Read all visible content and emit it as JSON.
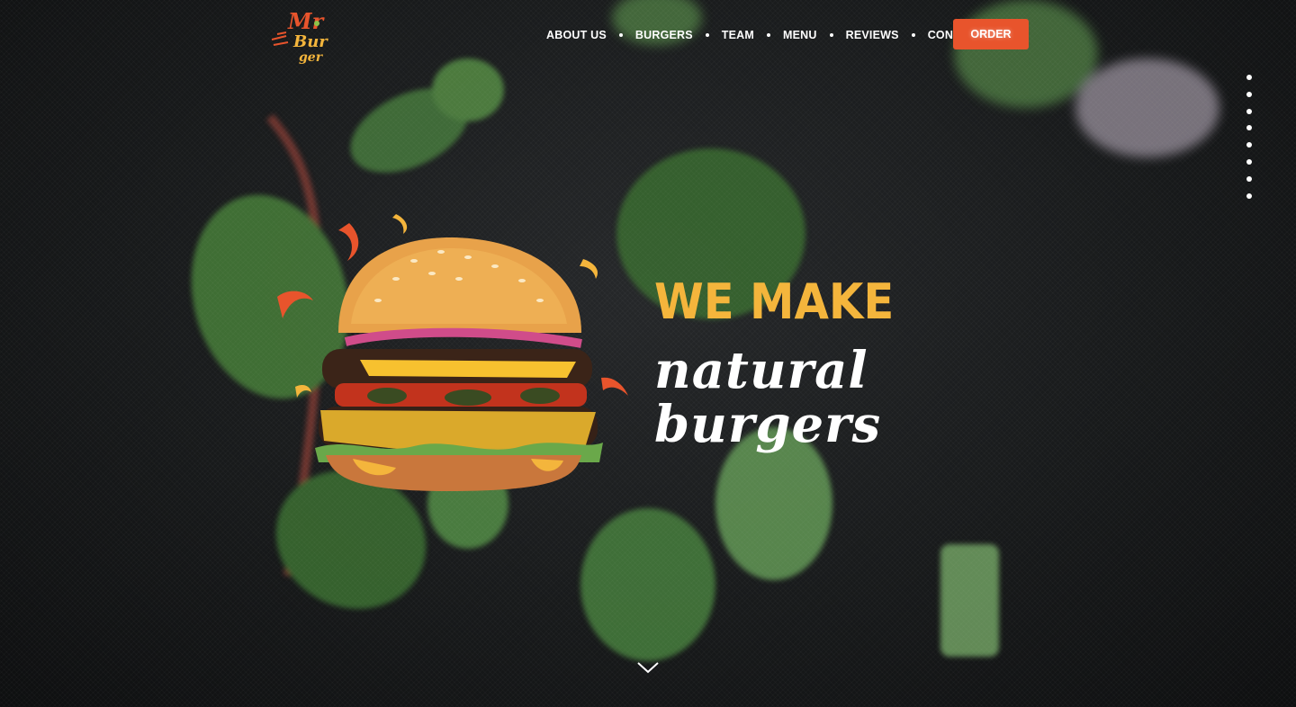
{
  "brand": {
    "logo_text": "Mr Burger",
    "colors": {
      "accent": "#e8542c",
      "yellow": "#f4b53c",
      "background": "#141516"
    }
  },
  "nav": {
    "items": [
      {
        "label": "ABOUT US"
      },
      {
        "label": "BURGERS"
      },
      {
        "label": "TEAM"
      },
      {
        "label": "MENU"
      },
      {
        "label": "REVIEWS"
      },
      {
        "label": "CONTACTS"
      }
    ],
    "order_label": "ORDER"
  },
  "pager": {
    "count": 8,
    "active_index": 0
  },
  "hero": {
    "line1": "WE MAKE",
    "line2": "natural",
    "line3": "burgers",
    "scroll_icon": "chevron-down-icon"
  }
}
